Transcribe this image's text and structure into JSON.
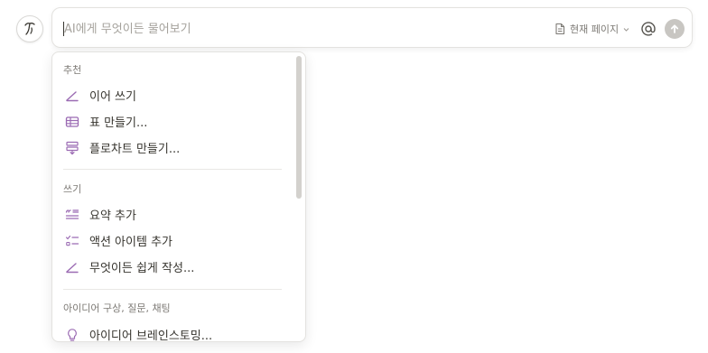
{
  "ai_bar": {
    "placeholder": "AI에게 무엇이든 물어보기",
    "context_label": "현재 페이지",
    "accent_color": "#9b6bb3"
  },
  "menu": {
    "sections": [
      {
        "title": "추천",
        "items": [
          {
            "label": "이어 쓰기",
            "icon": "pencil-icon"
          },
          {
            "label": "표 만들기...",
            "icon": "table-icon"
          },
          {
            "label": "플로차트 만들기...",
            "icon": "flowchart-icon"
          }
        ]
      },
      {
        "title": "쓰기",
        "items": [
          {
            "label": "요약 추가",
            "icon": "summary-icon"
          },
          {
            "label": "액션 아이템 추가",
            "icon": "checklist-icon"
          },
          {
            "label": "무엇이든 쉽게 작성...",
            "icon": "pencil-icon"
          }
        ]
      },
      {
        "title": "아이디어 구상, 질문, 채팅",
        "items": [
          {
            "label": "아이디어 브레인스토밍...",
            "icon": "lightbulb-icon"
          }
        ]
      }
    ]
  }
}
